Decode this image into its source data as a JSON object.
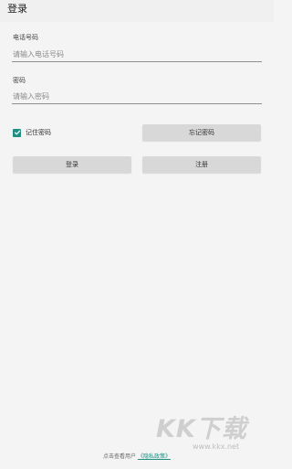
{
  "appbar": {
    "title": "登录"
  },
  "phone": {
    "label": "电话号码",
    "placeholder": "请输入电话号码",
    "value": ""
  },
  "password": {
    "label": "密码",
    "placeholder": "请输入密码",
    "value": ""
  },
  "remember": {
    "label": "记住密码",
    "checked": true
  },
  "buttons": {
    "forgot": "忘记密码",
    "login": "登录",
    "register": "注册"
  },
  "footer": {
    "prefix": "点击查看用户",
    "link": "《隐私政策》"
  },
  "watermark": {
    "text": "KK下载",
    "url": "www.kkx.net"
  },
  "colors": {
    "accent": "#1e8f82",
    "button_bg": "#d8d8d8",
    "background": "#f4f4f4"
  }
}
